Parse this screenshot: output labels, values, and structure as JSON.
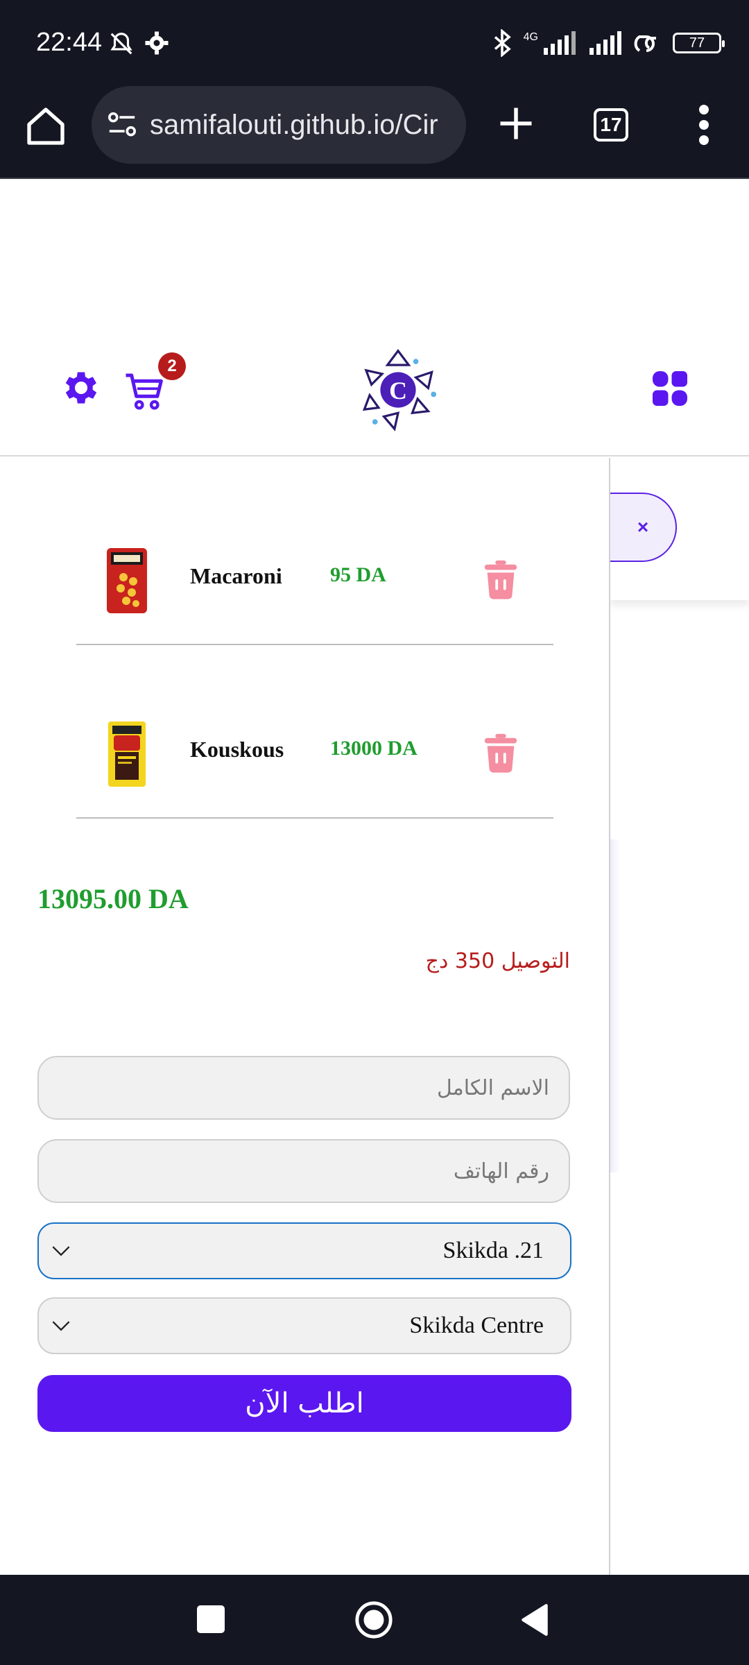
{
  "status_bar": {
    "time": "22:44",
    "network": "4G",
    "battery": "77"
  },
  "browser": {
    "url": "samifalouti.github.io/Cir",
    "tab_count": "17"
  },
  "header": {
    "cart_count": "2",
    "logo_letter": "C"
  },
  "cart": {
    "items": [
      {
        "name": "Macaroni",
        "price": "95 DA"
      },
      {
        "name": "Kouskous",
        "price": "13000 DA"
      }
    ],
    "total": "13095.00 DA",
    "delivery": "التوصيل 350 دج"
  },
  "form": {
    "name_placeholder": "الاسم الكامل",
    "phone_placeholder": "رقم الهاتف",
    "wilaya_value": "Skikda .21",
    "city_value": "Skikda Centre",
    "order_button": "اطلب الآن"
  },
  "side": {
    "close_label": "×"
  },
  "colors": {
    "accent": "#5b17f0",
    "price_green": "#1f9d2e",
    "badge_red": "#b71c1c",
    "trash_pink": "#f48ea0"
  }
}
